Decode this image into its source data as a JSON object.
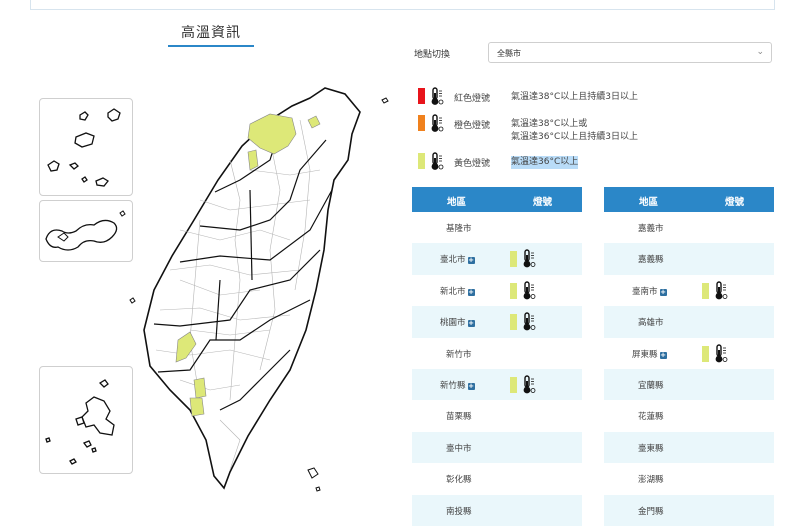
{
  "page": {
    "title": "高溫資訊"
  },
  "location": {
    "label": "地點切換",
    "selected": "全縣市"
  },
  "legend": [
    {
      "color": "#e8141b",
      "label": "紅色燈號",
      "desc_lines": [
        "氣溫達38°C以上且持續3日以上"
      ]
    },
    {
      "color": "#f0811d",
      "label": "橙色燈號",
      "desc_lines": [
        "氣溫達38°C以上或",
        "氣溫達36°C以上且持續3日以上"
      ]
    },
    {
      "color": "#dde878",
      "label": "黃色燈號",
      "desc_lines": [
        "氣溫達36°C以上"
      ]
    }
  ],
  "table_left": {
    "headers": {
      "region": "地區",
      "signal": "燈號"
    },
    "rows": [
      {
        "name": "基隆市",
        "expand": false,
        "signal": ""
      },
      {
        "name": "臺北市",
        "expand": true,
        "signal": "yellow"
      },
      {
        "name": "新北市",
        "expand": true,
        "signal": "yellow"
      },
      {
        "name": "桃園市",
        "expand": true,
        "signal": "yellow"
      },
      {
        "name": "新竹市",
        "expand": false,
        "signal": ""
      },
      {
        "name": "新竹縣",
        "expand": true,
        "signal": "yellow"
      },
      {
        "name": "苗栗縣",
        "expand": false,
        "signal": ""
      },
      {
        "name": "臺中市",
        "expand": false,
        "signal": ""
      },
      {
        "name": "彰化縣",
        "expand": false,
        "signal": ""
      },
      {
        "name": "南投縣",
        "expand": false,
        "signal": ""
      }
    ]
  },
  "table_right": {
    "headers": {
      "region": "地區",
      "signal": "燈號"
    },
    "rows": [
      {
        "name": "嘉義市",
        "expand": false,
        "signal": ""
      },
      {
        "name": "嘉義縣",
        "expand": false,
        "signal": ""
      },
      {
        "name": "臺南市",
        "expand": true,
        "signal": "yellow"
      },
      {
        "name": "高雄市",
        "expand": false,
        "signal": ""
      },
      {
        "name": "屏東縣",
        "expand": true,
        "signal": "yellow"
      },
      {
        "name": "宜蘭縣",
        "expand": false,
        "signal": ""
      },
      {
        "name": "花蓮縣",
        "expand": false,
        "signal": ""
      },
      {
        "name": "臺東縣",
        "expand": false,
        "signal": ""
      },
      {
        "name": "澎湖縣",
        "expand": false,
        "signal": ""
      },
      {
        "name": "金門縣",
        "expand": false,
        "signal": ""
      }
    ]
  },
  "colors": {
    "header_blue": "#2b87c8",
    "row_alt": "#eaf7fb",
    "yellow_signal": "#dde878"
  },
  "icons": {
    "thermometer": "thermometer-icon",
    "expand": "plus-square-icon",
    "dropdown": "chevron-down-icon"
  }
}
